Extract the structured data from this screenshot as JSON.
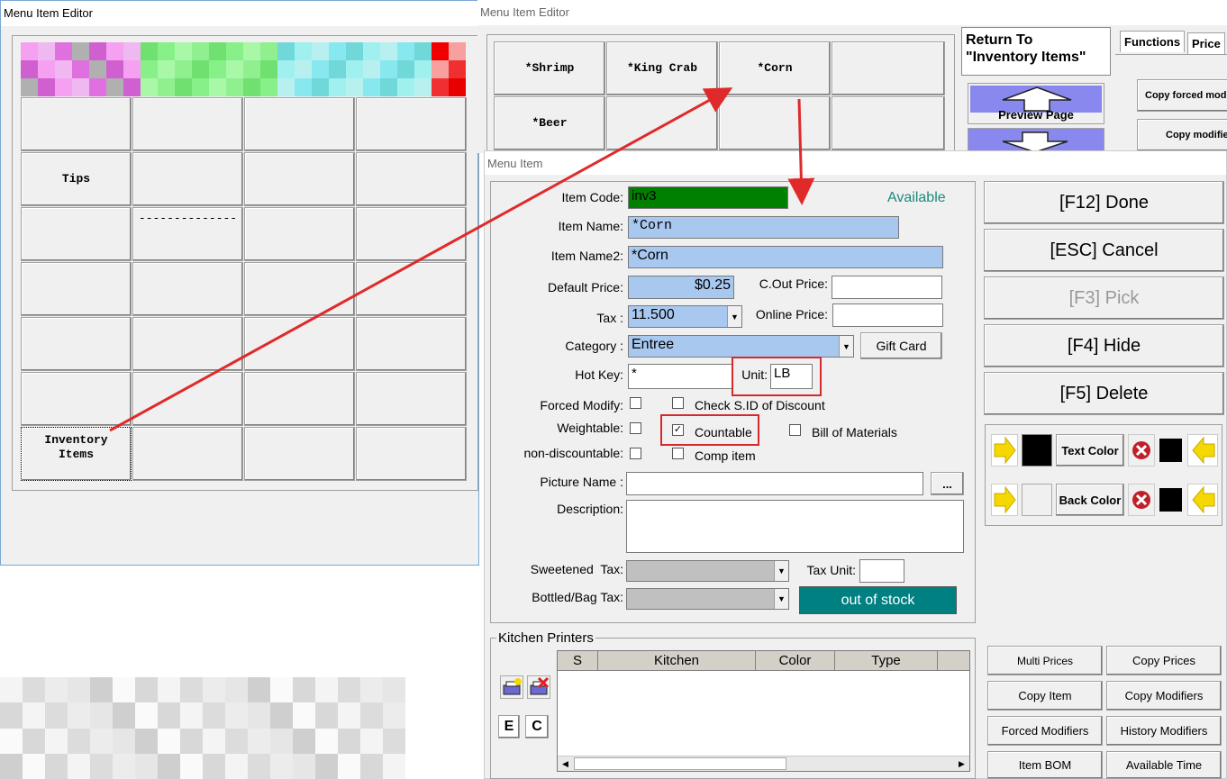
{
  "left_window": {
    "title": "Menu Item Editor",
    "grid_labels": [
      "Tips",
      "--------------",
      "Inventory\nItems"
    ]
  },
  "right_window": {
    "title": "Menu Item Editor",
    "item_buttons": [
      "*Shrimp",
      "*King Crab",
      "*Corn",
      "*Beer"
    ],
    "return_button": "Return To\n\"Inventory Items\"",
    "tabs": [
      "Functions",
      "Price"
    ],
    "preview_page": "Preview Page",
    "copy_forced": "Copy forced mod",
    "copy_modifiers": "Copy modifie"
  },
  "dialog": {
    "title": "Menu Item",
    "labels": {
      "item_code": "Item Code:",
      "item_name": "Item Name:",
      "item_name2": "Item Name2:",
      "default_price": "Default Price:",
      "cout_price": "C.Out Price:",
      "tax": "Tax :",
      "online_price": "Online Price:",
      "category": "Category :",
      "hot_key": "Hot Key:",
      "unit": "Unit:",
      "forced_modify": "Forced Modify:",
      "weightable": "Weightable:",
      "non_discountable": "non-discountable:",
      "check_sid": "Check S.ID of Discount",
      "countable": "Countable",
      "bill_of_materials": "Bill of Materials",
      "comp_item": "Comp item",
      "picture_name": "Picture Name :",
      "description": "Description:",
      "sweetened_tax": "Sweetened  Tax:",
      "bottled_bag_tax": "Bottled/Bag Tax:",
      "tax_unit": "Tax Unit:"
    },
    "values": {
      "item_code": "inv3",
      "status": "Available",
      "item_name": "*Corn",
      "item_name2": "*Corn",
      "default_price": "$0.25",
      "cout_price": "",
      "tax": "11.500",
      "online_price": "",
      "category": "Entree",
      "hot_key": "*",
      "unit": "LB",
      "picture_name": "",
      "description": "",
      "tax_unit": ""
    },
    "checks": {
      "forced_modify": false,
      "weightable": false,
      "non_discountable": false,
      "check_sid": false,
      "countable": true,
      "bill_of_materials": false,
      "comp_item": false
    },
    "buttons": {
      "gift_card": "Gift Card",
      "browse": "...",
      "out_of_stock": "out of stock",
      "done": "[F12] Done",
      "cancel": "[ESC] Cancel",
      "pick": "[F3] Pick",
      "hide": "[F4] Hide",
      "delete": "[F5] Delete",
      "text_color": "Text Color",
      "back_color": "Back Color",
      "e": "E",
      "c": "C",
      "multi_prices": "Multi Prices",
      "copy_prices": "Copy Prices",
      "copy_item": "Copy Item",
      "copy_modifiers": "Copy Modifiers",
      "forced_modifiers": "Forced Modifiers",
      "history_modifiers": "History Modifiers",
      "item_bom": "Item BOM",
      "available_time": "Available Time"
    },
    "kitchen_printers": {
      "title": "Kitchen Printers",
      "columns": [
        "S",
        "Kitchen",
        "Color",
        "Type"
      ]
    },
    "colors": {
      "item_code_bg": "#008000",
      "out_of_stock_bg": "#008080",
      "highlight": "#d62a2a",
      "arrow_yellow": "#f5d800"
    }
  }
}
